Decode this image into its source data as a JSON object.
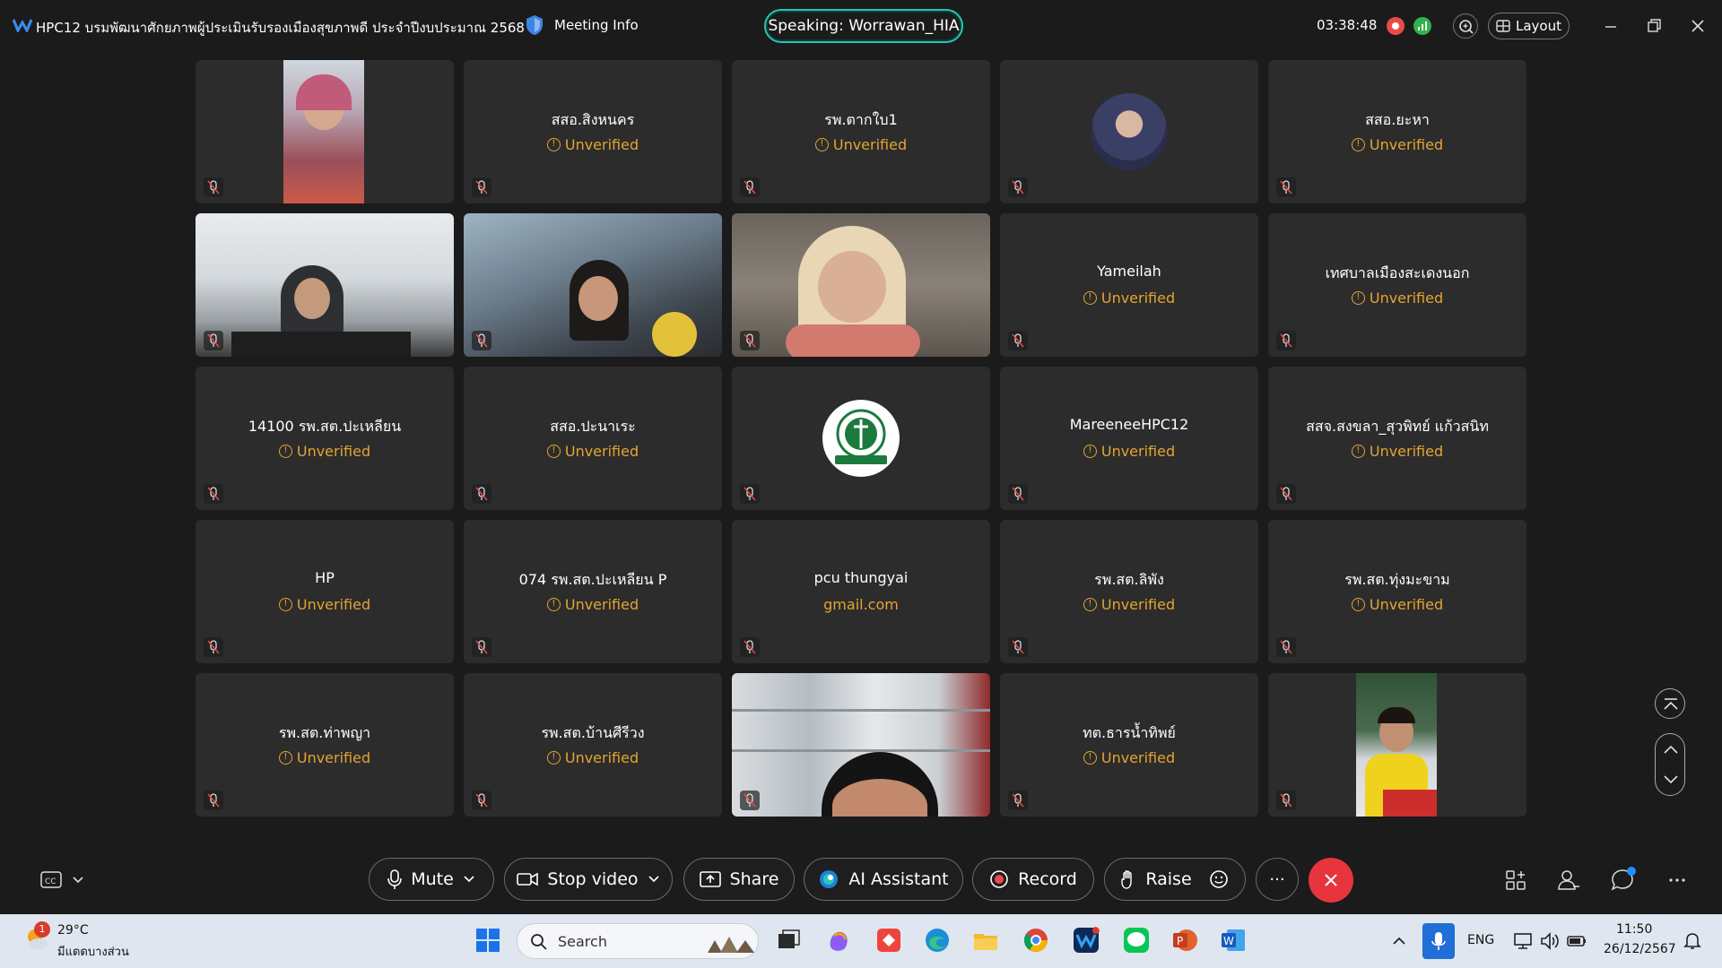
{
  "titlebar": {
    "meeting_title": "HPC12 บรมพัฒนาศักยภาพผู้ประเมินรับรองเมืองสุขภาพดี ประจำปีงบประมาณ 2568",
    "meeting_info": "Meeting Info",
    "speaking": "Speaking: Worrawan_HIA",
    "timer": "03:38:48",
    "layout": "Layout"
  },
  "tiles": [
    {
      "name": "",
      "status": ""
    },
    {
      "name": "สสอ.สิงหนคร",
      "status": "Unverified"
    },
    {
      "name": "รพ.ตากใบ1",
      "status": "Unverified"
    },
    {
      "name": "",
      "status": ""
    },
    {
      "name": "สสอ.ยะหา",
      "status": "Unverified"
    },
    {
      "name": "",
      "status": ""
    },
    {
      "name": "",
      "status": ""
    },
    {
      "name": "",
      "status": ""
    },
    {
      "name": "Yameilah",
      "status": "Unverified"
    },
    {
      "name": "เทศบาลเมืองสะเดงนอก",
      "status": "Unverified"
    },
    {
      "name": "14100 รพ.สต.ปะเหลียน",
      "status": "Unverified"
    },
    {
      "name": "สสอ.ปะนาเระ",
      "status": "Unverified"
    },
    {
      "name": "",
      "status": ""
    },
    {
      "name": "MareeneeHPC12",
      "status": "Unverified"
    },
    {
      "name": "สสจ.สงขลา_สุวพิทย์ แก้วสนิท",
      "status": "Unverified"
    },
    {
      "name": "HP",
      "status": "Unverified"
    },
    {
      "name": "074 รพ.สต.ปะเหลียน P",
      "status": "Unverified"
    },
    {
      "name": "pcu thungyai",
      "status": "gmail.com"
    },
    {
      "name": "รพ.สต.ลิพัง",
      "status": "Unverified"
    },
    {
      "name": "รพ.สต.ทุ่งมะขาม",
      "status": "Unverified"
    },
    {
      "name": "รพ.สต.ท่าพญา",
      "status": "Unverified"
    },
    {
      "name": "รพ.สต.บ้านศีรีวง",
      "status": "Unverified"
    },
    {
      "name": "",
      "status": ""
    },
    {
      "name": "ทต.ธารน้ำทิพย์",
      "status": "Unverified"
    },
    {
      "name": "",
      "status": ""
    }
  ],
  "toolbar": {
    "mute": "Mute",
    "stop_video": "Stop video",
    "share": "Share",
    "ai_assistant": "AI Assistant",
    "record": "Record",
    "raise": "Raise",
    "more": "···"
  },
  "taskbar": {
    "temp": "29°C",
    "weather_desc": "มีแดดบางส่วน",
    "weather_badge": "1",
    "search": "Search",
    "lang": "ENG",
    "time": "11:50",
    "date": "26/12/2567"
  },
  "colors": {
    "accent": "#27c4b4",
    "unverified": "#e3a531",
    "end_call": "#e8343c",
    "tile_bg": "#2c2c2c"
  }
}
